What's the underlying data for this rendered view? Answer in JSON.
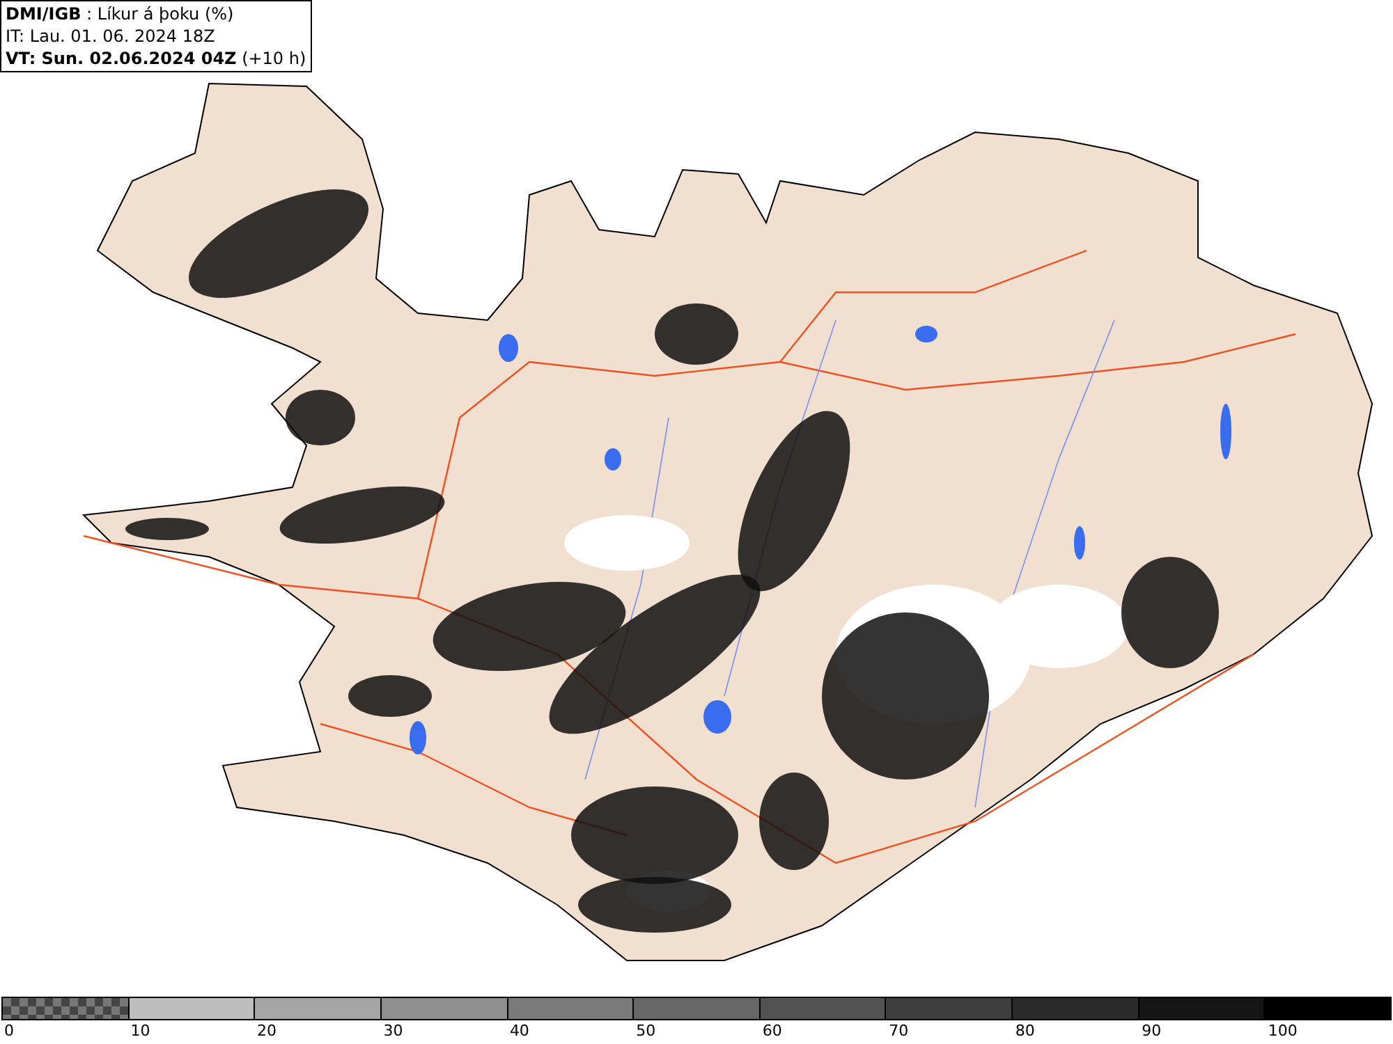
{
  "header": {
    "lines": [
      "**DMI/IGB** : Líkur á þoku (%)",
      "IT: Lau. 01. 06. 2024 18Z",
      "**VT: Sun. 02.06.2024 04Z** (+10 h)"
    ]
  },
  "legend": {
    "segments": [
      {
        "kind": "checker",
        "label": "0"
      },
      {
        "kind": "solid",
        "color": "#bdbdbd",
        "label": "10"
      },
      {
        "kind": "solid",
        "color": "#a5a5a5",
        "label": "20"
      },
      {
        "kind": "solid",
        "color": "#8f8f8f",
        "label": "30"
      },
      {
        "kind": "solid",
        "color": "#7a7a7a",
        "label": "40"
      },
      {
        "kind": "solid",
        "color": "#666666",
        "label": "50"
      },
      {
        "kind": "solid",
        "color": "#525252",
        "label": "60"
      },
      {
        "kind": "solid",
        "color": "#3e3e3e",
        "label": "70"
      },
      {
        "kind": "solid",
        "color": "#2a2a2a",
        "label": "80"
      },
      {
        "kind": "solid",
        "color": "#151515",
        "label": "90"
      },
      {
        "kind": "solid",
        "color": "#000000",
        "label": "100"
      }
    ]
  }
}
